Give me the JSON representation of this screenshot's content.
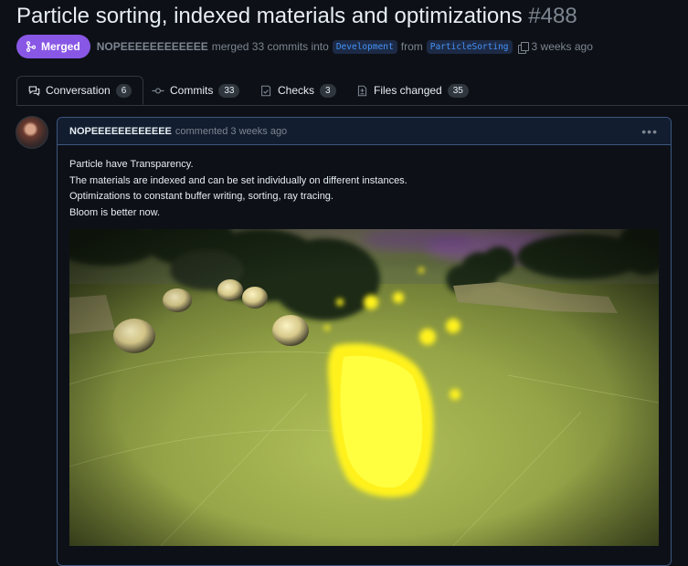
{
  "pr": {
    "title": "Particle sorting, indexed materials and optimizations",
    "number": "#488",
    "status": "Merged",
    "author": "NOPEEEEEEEEEEEE",
    "summary_merged": "merged 33 commits into",
    "base_branch": "Development",
    "from_word": "from",
    "head_branch": "ParticleSorting",
    "time": "3 weeks ago"
  },
  "tabs": [
    {
      "label": "Conversation",
      "count": "6",
      "icon": "comment-discussion-icon"
    },
    {
      "label": "Commits",
      "count": "33",
      "icon": "commit-icon"
    },
    {
      "label": "Checks",
      "count": "3",
      "icon": "checklist-icon"
    },
    {
      "label": "Files changed",
      "count": "35",
      "icon": "file-diff-icon"
    }
  ],
  "comment": {
    "author": "NOPEEEEEEEEEEEE",
    "action": "commented 3 weeks ago",
    "lines": [
      "Particle have Transparency.",
      "The materials are indexed and can be set individually on different instances.",
      "Optimizations to constant buffer writing, sorting, ray tracing.",
      "Bloom is better now."
    ]
  },
  "colors": {
    "merged_badge": "#8957e5",
    "accent_blue": "#4493f8",
    "background": "#0d1117"
  }
}
